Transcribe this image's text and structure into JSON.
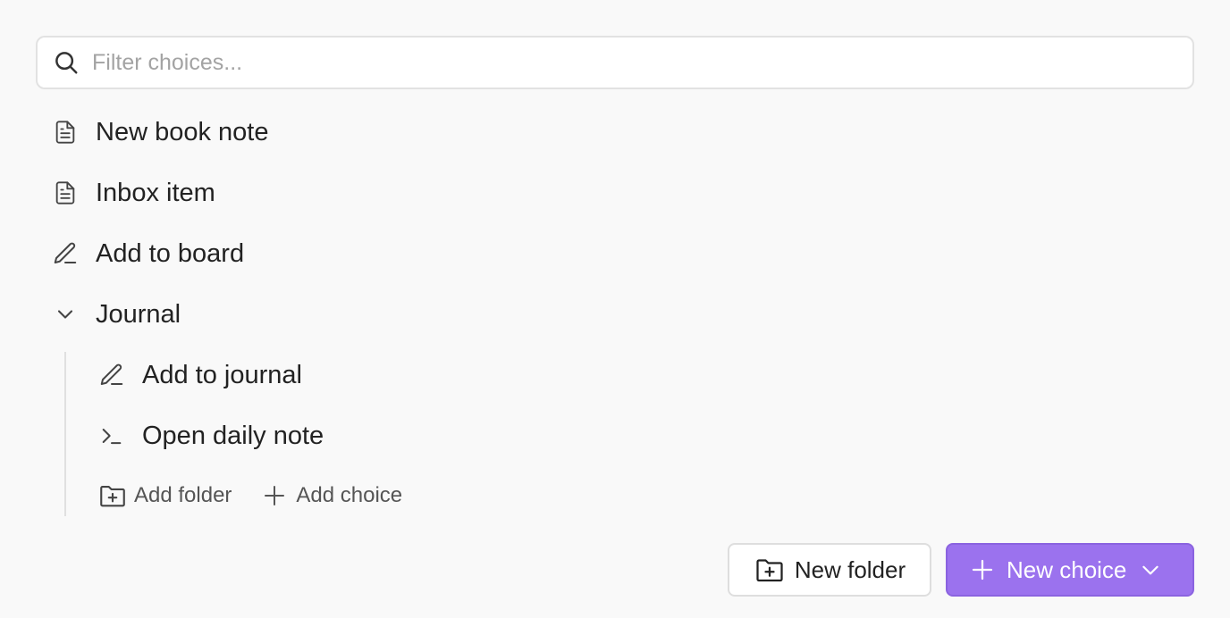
{
  "search": {
    "placeholder": "Filter choices...",
    "value": ""
  },
  "choices": [
    {
      "label": "New book note",
      "icon": "document-icon"
    },
    {
      "label": "Inbox item",
      "icon": "document-icon"
    },
    {
      "label": "Add to board",
      "icon": "pencil-icon"
    },
    {
      "label": "Journal",
      "icon": "chevron-down-icon",
      "expanded": true
    },
    {
      "label": "Add to journal",
      "icon": "pencil-icon"
    },
    {
      "label": "Open daily note",
      "icon": "terminal-icon"
    }
  ],
  "folder_actions": {
    "add_folder": "Add folder",
    "add_choice": "Add choice"
  },
  "footer": {
    "new_folder": "New folder",
    "new_choice": "New choice"
  },
  "colors": {
    "accent": "#9b72ee",
    "background": "#f9f9f9",
    "text": "#222222",
    "muted": "#555555"
  }
}
